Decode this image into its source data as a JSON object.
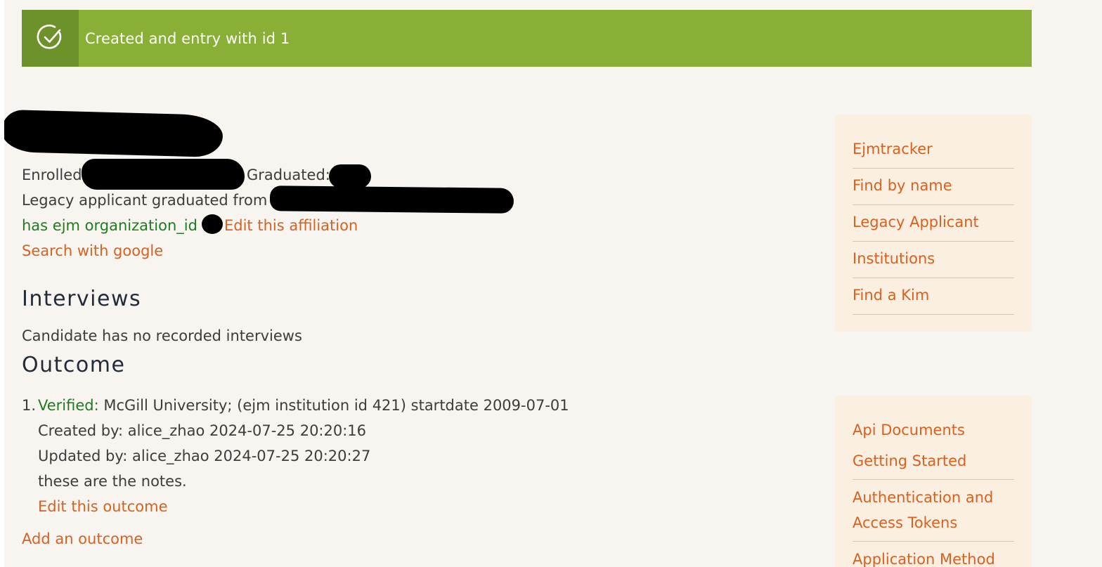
{
  "alert": {
    "message": "Created and entry with id 1",
    "icon": "check-circle-icon",
    "color": "#8aaf36"
  },
  "applicant": {
    "enrolled_label": "Enrolled",
    "graduated_label": "Graduated:",
    "legacy_text": "Legacy applicant graduated from",
    "org_text": "has ejm organization_id",
    "edit_affiliation": "Edit this affiliation",
    "search_google": "Search with google"
  },
  "interviews": {
    "heading": "Interviews",
    "empty": "Candidate has no recorded interviews"
  },
  "outcome": {
    "heading": "Outcome",
    "items": [
      {
        "number": "1.",
        "status": "Verified:",
        "detail": "McGill University; (ejm institution id 421) startdate 2009-07-01",
        "created": "Created by: alice_zhao 2024-07-25 20:20:16",
        "updated": "Updated by: alice_zhao 2024-07-25 20:20:27",
        "notes": "these are the notes.",
        "edit_label": "Edit this outcome"
      }
    ],
    "add_label": "Add an outcome"
  },
  "sidebar_nav": {
    "items": [
      "Ejmtracker",
      "Find by name",
      "Legacy Applicant",
      "Institutions",
      "Find a Kim"
    ]
  },
  "sidebar_docs": {
    "items": [
      "Api Documents",
      "Getting Started",
      "Authentication and",
      "Access Tokens",
      "Application Method"
    ]
  },
  "colors": {
    "link": "#d9601f",
    "success": "#1e7b1e",
    "sidebar_bg": "#fbefe2",
    "page_bg": "#f8f5f0"
  }
}
